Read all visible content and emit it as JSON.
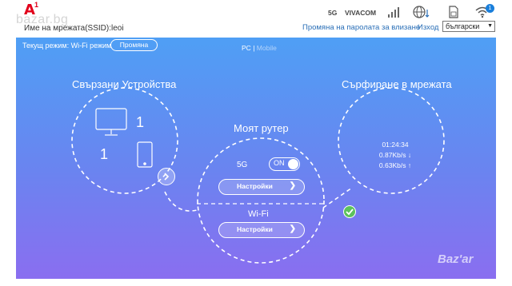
{
  "header": {
    "logo_text": "A",
    "logo_sup": "1",
    "watermark": "bazar.bg",
    "network_name": "Име на мрежата(SSID):leoi",
    "status": {
      "band": "5G",
      "operator": "VIVACOM",
      "wifi_clients": "1"
    },
    "change_password_link": "Промяна на паролата за влизане",
    "logout_link": "Изход",
    "language_selected": "български"
  },
  "panel": {
    "mode_label": "Текущ режим: Wi-Fi режим",
    "mode_button": "Промяна",
    "view_pc": "PC",
    "view_separator": "|",
    "view_mobile": "Mobile",
    "devices_title": "Свързани Устройства",
    "pc_count": "1",
    "mobile_count": "1",
    "router_title": "Моят рутер",
    "surf_title": "Сърфиране в мрежата",
    "traffic": {
      "time": "01:24:34",
      "down": "0.87Kb/s ↓",
      "up": "0.63Kb/s ↑"
    },
    "band_label": "5G",
    "toggle_text": "ON",
    "settings_5g": "Настройки",
    "wifi_label": "Wi-Fi",
    "settings_wifi": "Настройки",
    "bazar_mark": "Baz'ar"
  },
  "colors": {
    "brand_red": "#e2001a",
    "link_blue": "#2a6fb7",
    "panel_top": "#4f9ff5",
    "panel_bottom": "#8a6ef0",
    "ok_green": "#5cc25c"
  },
  "icons": [
    "signal-bars-icon",
    "globe-icon",
    "sim-card-icon",
    "wifi-icon",
    "monitor-icon",
    "phone-icon",
    "chevron-right-icon",
    "check-icon"
  ]
}
